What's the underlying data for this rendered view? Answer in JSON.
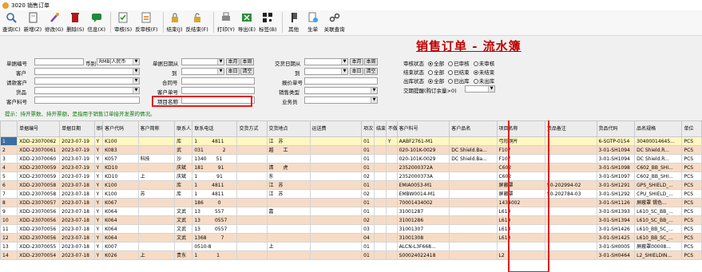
{
  "window": {
    "title": "3020 销售订单"
  },
  "toolbar": [
    {
      "label": "查询(C)",
      "icon": "search-icon"
    },
    {
      "label": "新增(Z)",
      "icon": "new-doc-icon"
    },
    {
      "label": "修改(G)",
      "icon": "edit-icon"
    },
    {
      "label": "删除(S)",
      "icon": "delete-icon"
    },
    {
      "label": "信息(X)",
      "icon": "message-icon"
    },
    {
      "label": "审核(S)",
      "icon": "approve-icon"
    },
    {
      "label": "反审核(F)",
      "icon": "unapprove-icon"
    },
    {
      "label": "结束(J)",
      "icon": "lock-icon"
    },
    {
      "label": "反结束(F)",
      "icon": "unlock-icon"
    },
    {
      "label": "打印(Y)",
      "icon": "print-icon"
    },
    {
      "label": "导出(E)",
      "icon": "export-icon"
    },
    {
      "label": "标签(B)",
      "icon": "barcode-icon"
    },
    {
      "label": "其他",
      "icon": "other-icon"
    },
    {
      "label": "生单",
      "icon": "generate-icon"
    },
    {
      "label": "关联查询",
      "icon": "link-icon"
    }
  ],
  "page_title": "销售订单 - 流水簿",
  "filters": {
    "order_no": "单据编号",
    "currency": "币别",
    "currency_value": "RMB|人民币",
    "customer": "客户",
    "invoice_customer": "请款客户",
    "product": "货品",
    "customer_part_no": "客户料号",
    "date_from": "单据日期从",
    "date_to": "到",
    "contract_no": "合同号",
    "customer_order_no": "客户单号",
    "project_name": "项目名称",
    "trade_date_from": "交货日期从",
    "trade_date_to": "到",
    "quote_no": "报价单号",
    "sales_type": "销售类型",
    "salesperson": "业务员",
    "btn_month": "本月",
    "btn_week": "本周",
    "btn_day": "本日",
    "btn_clear": "清空",
    "audit_status": "审核状态",
    "end_status": "结束状态",
    "stock_status": "出库状态",
    "due_reminder": "交期提醒(购订余量>0)",
    "opt_all": "全部",
    "opt_audited": "已审核",
    "opt_unaudited": "未审核",
    "opt_ended": "已结束",
    "opt_unended": "未结束",
    "opt_out": "已出库",
    "opt_notout": "未出库"
  },
  "hint": "提示：持开票数、持开票额，是指用于销售订单接开发票的情况。",
  "columns": [
    "",
    "单据编号",
    "单据日期",
    "审核",
    "客户代码",
    "客户简称",
    "联系人",
    "联系电话",
    "交货方式",
    "交货地点",
    "运送费",
    "项次",
    "结束标记",
    "不做MRP",
    "客户料号",
    "客户品名",
    "项目名称",
    "货品备注",
    "货品代码",
    "品名规格",
    "单位"
  ],
  "rows": [
    [
      "1",
      "XDD-23070062",
      "2023-07-19",
      "Y",
      "K100",
      "",
      "库",
      "1　　　4811",
      "",
      "江　苏",
      "",
      "01",
      "",
      "Y",
      "AABF2761-M1",
      "",
      "弓形铜片",
      "",
      "6-SGTP-0154",
      "30400014645...",
      "PCS"
    ],
    [
      "2",
      "XDD-23070061",
      "2023-07-19",
      "Y",
      "K083",
      "",
      "武",
      "031　　　　2",
      "",
      "越　　工",
      "",
      "01",
      "",
      "",
      "020-101K-0029",
      "DC Shield.Ba...",
      "F107",
      "",
      "3-01-SH1094",
      "DC Shield.R...",
      "PCS"
    ],
    [
      "3",
      "XDD-23070060",
      "2023-07-19",
      "Y",
      "K057",
      "科技",
      "沙",
      "1340　　51",
      "",
      "",
      "",
      "01",
      "",
      "",
      "020-101K-0029",
      "DC Shield.Ba...",
      "F107",
      "",
      "3-01-SH1094",
      "DC Shield.R...",
      "PCS"
    ],
    [
      "4",
      "XDD-23070059",
      "2023-07-19",
      "Y",
      "KD10",
      "",
      "庆斌",
      "181　　　91",
      "",
      "清　　虎",
      "",
      "01",
      "",
      "",
      "2352000372A",
      "",
      "C602",
      "",
      "3-01-SH1098",
      "C602_BB_SHI...",
      "PCS"
    ],
    [
      "5",
      "XDD-23070059",
      "2023-07-19",
      "Y",
      "KD10",
      "上",
      "庆斌",
      "1　　　　91",
      "",
      "东",
      "",
      "02",
      "",
      "",
      "2352000373A",
      "",
      "C602",
      "",
      "3-01-SH1097",
      "C602_BB_SHI...",
      "PCS"
    ],
    [
      "6",
      "XDD-23070058",
      "2023-07-18",
      "Y",
      "K100",
      "",
      "库",
      "1　　　4811",
      "",
      "江　苏",
      "",
      "01",
      "",
      "",
      "EMIA0053-M1",
      "",
      "屏蔽罩",
      "50-202994-02",
      "3-01-SH1291",
      "GPS_SHIELD_...",
      "PCS"
    ],
    [
      "7",
      "XDD-23070058",
      "2023-07-18",
      "Y",
      "K100",
      "苏",
      "库",
      "1　　　4811",
      "",
      "江　苏",
      "",
      "02",
      "",
      "",
      "EMBW0014-M1",
      "",
      "屏蔽罩",
      "50-202784-03",
      "3-01-SH1292",
      "CPU_SHIELD_...",
      "PCS"
    ],
    [
      "8",
      "XDD-23070057",
      "2023-07-18",
      "Y",
      "K067",
      "",
      "",
      "186　　　0",
      "",
      "",
      "",
      "01",
      "",
      "",
      "70001434002",
      "",
      "1434002",
      "",
      "3-01-SH1126",
      "屏蔽罩 锡色...",
      "PCS"
    ],
    [
      "9",
      "XDD-23070056",
      "2023-07-18",
      "Y",
      "K064",
      "",
      "文武",
      "13　　　557",
      "",
      "嘉",
      "",
      "01",
      "",
      "",
      "31001287",
      "",
      "L610",
      "",
      "3-01-SH1393",
      "L610_SC_BB_...",
      "PCS"
    ],
    [
      "10",
      "XDD-23070056",
      "2023-07-18",
      "Y",
      "K064",
      "",
      "文武",
      "13　　　0557",
      "",
      "",
      "",
      "02",
      "",
      "",
      "31001286",
      "",
      "L610",
      "",
      "3-01-SH1394",
      "L610_SC_BB_...",
      "PCS"
    ],
    [
      "11",
      "XDD-23070056",
      "2023-07-18",
      "Y",
      "K064",
      "",
      "文武",
      "13　　　0557",
      "",
      "",
      "",
      "03",
      "",
      "",
      "31001307",
      "",
      "L610",
      "",
      "3-01-SH1426",
      "L610_BB_SC_...",
      "PCS"
    ],
    [
      "12",
      "XDD-23070056",
      "2023-07-18",
      "Y",
      "K064",
      "",
      "文武",
      "1368　　　7",
      "",
      "",
      "",
      "04",
      "",
      "",
      "31001308",
      "",
      "L610",
      "",
      "3-01-SH1425",
      "L610_BB_SC_...",
      "PCS"
    ],
    [
      "13",
      "XDD-23070055",
      "2023-07-18",
      "Y",
      "K007",
      "",
      "",
      "0510-8",
      "",
      "上",
      "",
      "01",
      "",
      "",
      "ALCN-L3F668...",
      "",
      "",
      "",
      "3-01-SH0005",
      "屏蔽罩00008...",
      "PCS"
    ],
    [
      "14",
      "XDD-23070054",
      "2023-07-18",
      "Y",
      "K026",
      "上",
      "贵东",
      "1　　　　1",
      "",
      "",
      "",
      "01",
      "",
      "",
      "S00024022418",
      "",
      "L2",
      "",
      "3-01-SH0464",
      "L2_SHIELDIN...",
      "PCS"
    ]
  ]
}
